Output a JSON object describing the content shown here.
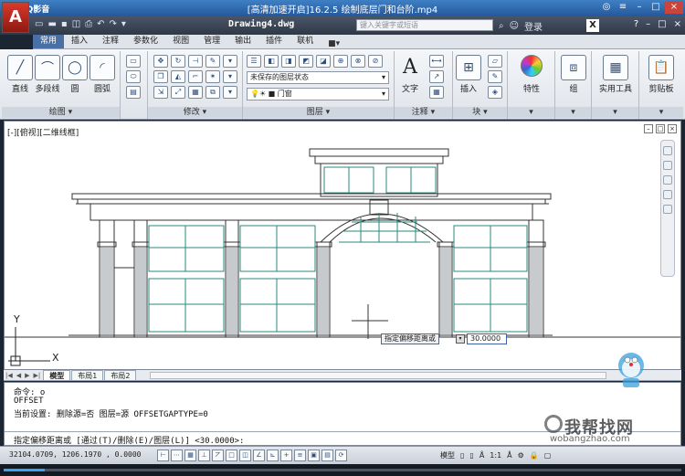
{
  "player": {
    "name": "QQ影音",
    "title": "[高清加速开启]16.2.5 绘制底层门和台阶.mp4",
    "progress": 0.06
  },
  "acad": {
    "document": "Drawing4.dwg",
    "search_placeholder": "键入关键字或短语",
    "login": "登录"
  },
  "tabs": [
    "常用",
    "插入",
    "注释",
    "参数化",
    "视图",
    "管理",
    "输出",
    "插件",
    "联机"
  ],
  "ribbon": {
    "draw": {
      "title": "绘图",
      "tools": [
        "直线",
        "多段线",
        "圆",
        "圆弧"
      ]
    },
    "modify": {
      "title": "修改"
    },
    "layers": {
      "title": "图层",
      "state": "未保存的图层状态",
      "current": "门窗"
    },
    "annotation": {
      "title": "注释",
      "text": "文字"
    },
    "block": {
      "title": "块",
      "insert": "插入"
    },
    "properties": {
      "label": "特性"
    },
    "groups": {
      "label": "组"
    },
    "utilities": {
      "label": "实用工具"
    },
    "clipboard": {
      "label": "剪贴板"
    }
  },
  "drawing": {
    "view_label": "[-][俯视][二维线框]",
    "tooltip": "指定偏移距离或",
    "input_value": "30.0000",
    "axis_y": "Y",
    "axis_x": "X"
  },
  "layout_tabs": [
    "模型",
    "布局1",
    "布局2"
  ],
  "command": {
    "line1": "命令: o",
    "line2": "OFFSET",
    "line3": "当前设置: 删除源=否  图层=源  OFFSETGAPTYPE=0",
    "prompt": "指定偏移距离或 [通过(T)/删除(E)/图层(L)] <30.0000>:"
  },
  "status": {
    "coords": "32104.0709, 1206.1970 , 0.0000",
    "model": "模型",
    "scale": "1:1"
  },
  "watermark": {
    "main": "我帮找网",
    "sub": "wobangzhao.com"
  }
}
